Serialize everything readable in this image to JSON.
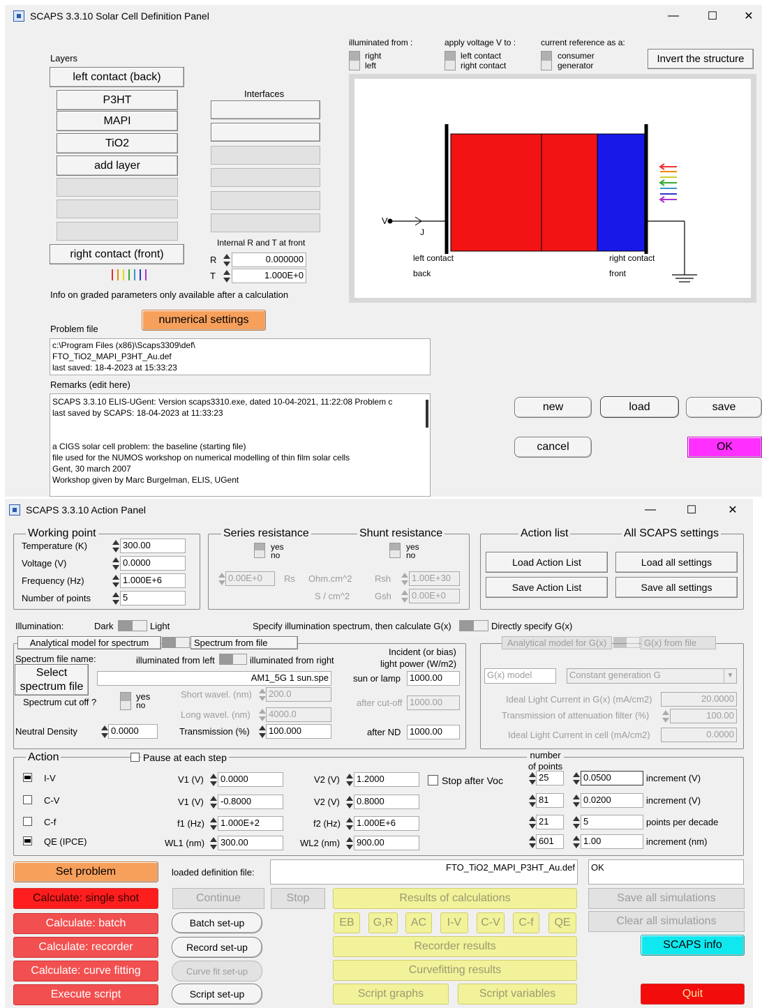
{
  "definition_panel": {
    "title": "SCAPS 3.3.10 Solar Cell Definition Panel",
    "layers_label": "Layers",
    "left_contact": "left contact (back)",
    "layers": [
      "P3HT",
      "MAPI",
      "TiO2",
      "add layer"
    ],
    "right_contact": "right contact (front)",
    "interfaces_label": "Interfaces",
    "internal_rt_label": "Internal R and T at front",
    "r_label": "R",
    "r_value": "0.000000",
    "t_label": "T",
    "t_value": "1.000E+0",
    "graded_info": "Info on graded parameters only available after a calculation",
    "numerical_settings": "numerical settings",
    "problem_file_label": "Problem file",
    "problem_file_lines": [
      "c:\\Program Files (x86)\\Scaps3309\\def\\",
      "FTO_TiO2_MAPI_P3HT_Au.def",
      "last saved: 18-4-2023 at 15:33:23"
    ],
    "remarks_label": "Remarks (edit here)",
    "remarks_lines": [
      "SCAPS 3.3.10 ELIS-UGent: Version scaps3310.exe, dated 10-04-2021, 11:22:08 Problem c",
      "last saved by SCAPS: 18-04-2023 at 11:33:23",
      "",
      "",
      "a CIGS solar cell problem: the baseline (starting file)",
      "file used for the NUMOS workshop on numerical modelling of thin film solar cells",
      "Gent, 30 march 2007",
      "Workshop given by Marc Burgelman, ELIS, UGent"
    ],
    "illuminated_from": {
      "label": "illuminated from :",
      "opt1": "right",
      "opt2": "left"
    },
    "apply_voltage": {
      "label": "apply voltage V to :",
      "opt1": "left contact",
      "opt2": "right contact"
    },
    "current_reference": {
      "label": "current reference as a:",
      "opt1": "consumer",
      "opt2": "generator"
    },
    "invert_button": "Invert the structure",
    "diagram": {
      "v_label": "V",
      "j_label": "J",
      "left_contact": "left contact",
      "back": "back",
      "right_contact": "right contact",
      "front": "front"
    },
    "buttons": {
      "new": "new",
      "load": "load",
      "save": "save",
      "cancel": "cancel",
      "ok": "OK"
    }
  },
  "action_panel": {
    "title": "SCAPS 3.3.10 Action Panel",
    "working_point": {
      "title": "Working point",
      "temperature_label": "Temperature (K)",
      "temperature": "300.00",
      "voltage_label": "Voltage (V)",
      "voltage": "0.0000",
      "frequency_label": "Frequency (Hz)",
      "frequency": "1.000E+6",
      "points_label": "Number of points",
      "points": "5"
    },
    "series_resistance": {
      "title": "Series resistance",
      "yes": "yes",
      "no": "no",
      "value": "0.00E+0",
      "rs": "Rs",
      "unit1": "Ohm.cm^2",
      "unit2": "S / cm^2"
    },
    "shunt_resistance": {
      "title": "Shunt resistance",
      "yes": "yes",
      "no": "no",
      "rsh": "Rsh",
      "value1": "1.00E+30",
      "gsh": "Gsh",
      "value2": "0.00E+0"
    },
    "action_list": {
      "title": "Action list",
      "load": "Load Action List",
      "save": "Save Action List"
    },
    "all_settings": {
      "title": "All SCAPS settings",
      "load": "Load all settings",
      "save": "Save all settings"
    },
    "illumination": {
      "label": "Illumination:",
      "dark": "Dark",
      "light": "Light",
      "specify_spectrum": "Specify illumination spectrum, then calculate G(x)",
      "directly": "Directly specify G(x)"
    },
    "spectrum": {
      "tab1": "Analytical model for spectrum",
      "tab2": "Spectrum from file",
      "file_name_label": "Spectrum file name:",
      "illum_left": "illuminated from left",
      "illum_right": "illuminated from right",
      "select_button_l1": "Select",
      "select_button_l2": "spectrum file",
      "file": "AM1_5G 1 sun.spe",
      "cutoff_label": "Spectrum cut off ?",
      "yes": "yes",
      "no": "no",
      "short_label": "Short wavel. (nm)",
      "short": "200.0",
      "long_label": "Long wavel. (nm)",
      "long": "4000.0",
      "nd_label": "Neutral Density",
      "nd": "0.0000",
      "trans_label": "Transmission (%)",
      "trans": "100.000",
      "incident_l1": "Incident (or bias)",
      "incident_l2": "light power (W/m2)",
      "sun_label": "sun or lamp",
      "sun": "1000.00",
      "cutoff_after_label": "after cut-off",
      "cutoff_after": "1000.00",
      "nd_after_label": "after ND",
      "nd_after": "1000.00"
    },
    "gx": {
      "tab1": "Analytical model for G(x)",
      "tab2": "G(x) from file",
      "model_label": "G(x) model",
      "model": "Constant generation G",
      "ideal_label": "Ideal Light Current in G(x) (mA/cm2)",
      "ideal": "20.0000",
      "trans_label": "Transmission of attenuation filter (%)",
      "trans": "100.00",
      "cell_label": "Ideal Light Current in cell (mA/cm2)",
      "cell": "0.0000"
    },
    "action": {
      "title": "Action",
      "pause": "Pause at each step",
      "number_of_points": "number\nof points",
      "rows": [
        {
          "name": "I-V",
          "on": true,
          "p1": "V1 (V)",
          "v1": "0.0000",
          "p2": "V2 (V)",
          "v2": "1.2000",
          "n": "25",
          "inc": "0.0500",
          "inc_label": "increment (V)"
        },
        {
          "name": "C-V",
          "on": false,
          "p1": "V1 (V)",
          "v1": "-0.8000",
          "p2": "V2 (V)",
          "v2": "0.8000",
          "n": "81",
          "inc": "0.0200",
          "inc_label": "increment (V)"
        },
        {
          "name": "C-f",
          "on": false,
          "p1": "f1 (Hz)",
          "v1": "1.000E+2",
          "p2": "f2 (Hz)",
          "v2": "1.000E+6",
          "n": "21",
          "inc": "5",
          "inc_label": "points per decade"
        },
        {
          "name": "QE (IPCE)",
          "on": true,
          "p1": "WL1 (nm)",
          "v1": "300.00",
          "p2": "WL2 (nm)",
          "v2": "900.00",
          "n": "601",
          "inc": "1.00",
          "inc_label": "increment (nm)"
        }
      ],
      "stop_after_voc": "Stop after Voc"
    },
    "bottom": {
      "set_problem": "Set problem",
      "loaded_label": "loaded definition file:",
      "loaded_file": "FTO_TiO2_MAPI_P3HT_Au.def",
      "status": "OK",
      "calc_single": "Calculate: single shot",
      "calc_batch": "Calculate: batch",
      "calc_recorder": "Calculate: recorder",
      "calc_fitting": "Calculate: curve fitting",
      "execute_script": "Execute script",
      "continue": "Continue",
      "stop": "Stop",
      "batch_setup": "Batch set-up",
      "record_setup": "Record set-up",
      "curvefit_setup": "Curve fit set-up",
      "script_setup": "Script set-up",
      "results": "Results of calculations",
      "eb": "EB",
      "gr": "G,R",
      "ac": "AC",
      "iv": "I-V",
      "cv": "C-V",
      "cf": "C-f",
      "qe": "QE",
      "recorder_results": "Recorder results",
      "curvefitting_results": "Curvefitting results",
      "script_graphs": "Script graphs",
      "script_variables": "Script variables",
      "save_all": "Save all simulations",
      "clear_all": "Clear all simulations",
      "info": "SCAPS info",
      "quit": "Quit"
    }
  }
}
